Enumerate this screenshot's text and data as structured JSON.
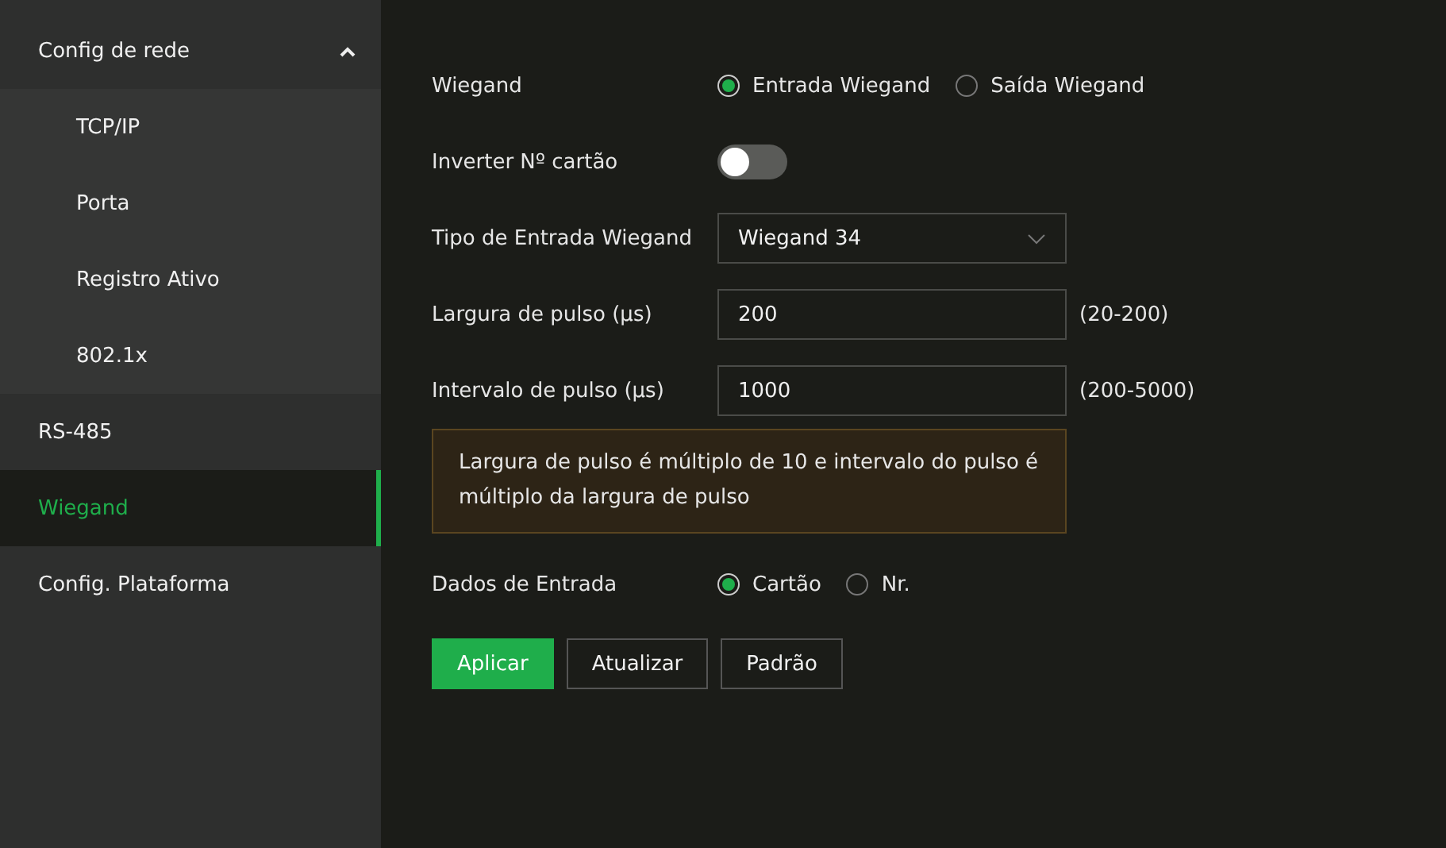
{
  "sidebar": {
    "items": [
      {
        "label": "Config de rede",
        "selected": false,
        "expanded": true,
        "children": [
          {
            "label": "TCP/IP",
            "selected": false
          },
          {
            "label": "Porta",
            "selected": false
          },
          {
            "label": "Registro Ativo",
            "selected": false
          },
          {
            "label": "802.1x",
            "selected": false
          }
        ]
      },
      {
        "label": "RS-485",
        "selected": false
      },
      {
        "label": "Wiegand",
        "selected": true
      },
      {
        "label": "Config. Plataforma",
        "selected": false
      }
    ]
  },
  "form": {
    "rows": [
      {
        "kind": "radio",
        "label": "Wiegand",
        "options": [
          {
            "label": "Entrada Wiegand",
            "selected": true
          },
          {
            "label": "Saída Wiegand",
            "selected": false
          }
        ]
      },
      {
        "kind": "toggle",
        "label": "Inverter Nº cartão",
        "on": false
      },
      {
        "kind": "select",
        "label": "Tipo de Entrada Wiegand",
        "value": "Wiegand 34"
      },
      {
        "kind": "input",
        "label": "Largura de pulso (μs)",
        "value": "200",
        "range": "(20-200)"
      },
      {
        "kind": "input",
        "label": "Intervalo de pulso (μs)",
        "value": "1000",
        "range": "(200-5000)"
      },
      {
        "kind": "notice",
        "text": "Largura de pulso é múltiplo de 10 e intervalo do pulso é múltiplo da largura de pulso"
      },
      {
        "kind": "radio",
        "label": "Dados de Entrada",
        "options": [
          {
            "label": "Cartão",
            "selected": true
          },
          {
            "label": "Nr.",
            "selected": false
          }
        ]
      }
    ]
  },
  "buttons": [
    {
      "label": "Aplicar",
      "kind": "primary"
    },
    {
      "label": "Atualizar",
      "kind": "default"
    },
    {
      "label": "Padrão",
      "kind": "default"
    }
  ]
}
